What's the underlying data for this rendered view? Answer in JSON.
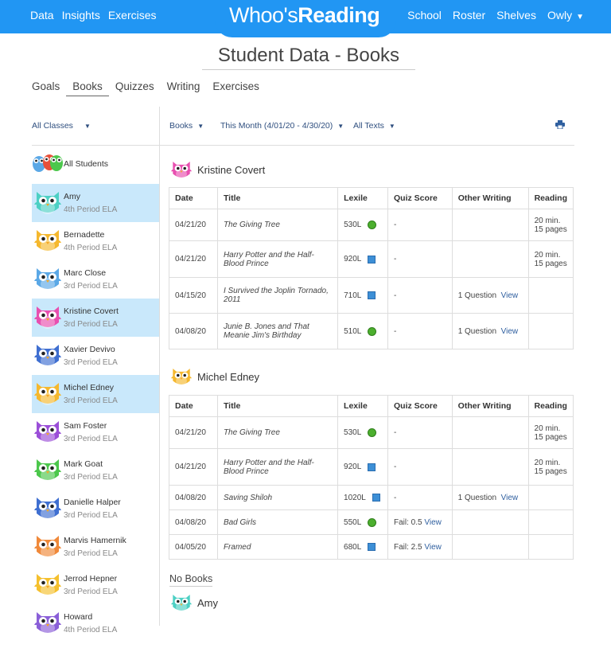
{
  "nav": {
    "left": [
      "Data",
      "Insights",
      "Exercises"
    ],
    "right": [
      "School",
      "Roster",
      "Shelves"
    ],
    "user": "Owly",
    "brand_color": "#2196f3"
  },
  "logo": {
    "part1": "Wh",
    "part2": "oo",
    "part3": "'s",
    "part4": "Reading"
  },
  "page_title": "Student Data - Books",
  "tabs": [
    "Goals",
    "Books",
    "Quizzes",
    "Writing",
    "Exercises"
  ],
  "active_tab": "Books",
  "filters": {
    "classes": "All Classes",
    "type": "Books",
    "range": "This Month (4/01/20 - 4/30/20)",
    "texts": "All Texts"
  },
  "print_icon": "printer-icon",
  "sidebar": {
    "all_label": "All Students",
    "students": [
      {
        "name": "Amy",
        "class": "4th Period ELA",
        "selected": true,
        "color": "#4dd0c4"
      },
      {
        "name": "Bernadette",
        "class": "4th Period ELA",
        "selected": false,
        "color": "#f5b82e"
      },
      {
        "name": "Marc Close",
        "class": "3rd Period ELA",
        "selected": false,
        "color": "#5ba8e6"
      },
      {
        "name": "Kristine Covert",
        "class": "3rd Period ELA",
        "selected": true,
        "color": "#e84fb0"
      },
      {
        "name": "Xavier Devivo",
        "class": "3rd Period ELA",
        "selected": false,
        "color": "#3f6fd1"
      },
      {
        "name": "Michel Edney",
        "class": "3rd Period ELA",
        "selected": true,
        "color": "#f5b82e"
      },
      {
        "name": "Sam Foster",
        "class": "3rd Period ELA",
        "selected": false,
        "color": "#9b4fd8"
      },
      {
        "name": "Mark Goat",
        "class": "3rd Period ELA",
        "selected": false,
        "color": "#4cc74c"
      },
      {
        "name": "Danielle Halper",
        "class": "3rd Period ELA",
        "selected": false,
        "color": "#3f6fd1"
      },
      {
        "name": "Marvis Hamernik",
        "class": "3rd Period ELA",
        "selected": false,
        "color": "#f0893a"
      },
      {
        "name": "Jerrod Hepner",
        "class": "3rd Period ELA",
        "selected": false,
        "color": "#f5c02e"
      },
      {
        "name": "Howard",
        "class": "4th Period ELA",
        "selected": false,
        "color": "#8a5fd8"
      }
    ]
  },
  "columns": [
    "Date",
    "Title",
    "Lexile",
    "Quiz Score",
    "Other Writing",
    "Reading"
  ],
  "sections": [
    {
      "student": "Kristine Covert",
      "color": "#e84fb0",
      "rows": [
        {
          "date": "04/21/20",
          "title": "The Giving Tree",
          "lexile": "530L",
          "marker": "dot",
          "quiz": "-",
          "quiz_view": "",
          "writing": "",
          "writing_view": "",
          "reading1": "20 min.",
          "reading2": "15 pages"
        },
        {
          "date": "04/21/20",
          "title": "Harry Potter and the Half-Blood Prince",
          "lexile": "920L",
          "marker": "square",
          "quiz": "-",
          "quiz_view": "",
          "writing": "",
          "writing_view": "",
          "reading1": "20 min.",
          "reading2": "15 pages"
        },
        {
          "date": "04/15/20",
          "title": "I Survived the Joplin Tornado, 2011",
          "lexile": "710L",
          "marker": "square",
          "quiz": "-",
          "quiz_view": "",
          "writing": "1 Question",
          "writing_view": "View",
          "reading1": "",
          "reading2": ""
        },
        {
          "date": "04/08/20",
          "title": "Junie B. Jones and That Meanie Jim's Birthday",
          "lexile": "510L",
          "marker": "dot",
          "quiz": "-",
          "quiz_view": "",
          "writing": "1 Question",
          "writing_view": "View",
          "reading1": "",
          "reading2": ""
        }
      ]
    },
    {
      "student": "Michel Edney",
      "color": "#f5b82e",
      "rows": [
        {
          "date": "04/21/20",
          "title": "The Giving Tree",
          "lexile": "530L",
          "marker": "dot",
          "quiz": "-",
          "quiz_view": "",
          "writing": "",
          "writing_view": "",
          "reading1": "20 min.",
          "reading2": "15 pages"
        },
        {
          "date": "04/21/20",
          "title": "Harry Potter and the Half-Blood Prince",
          "lexile": "920L",
          "marker": "square",
          "quiz": "-",
          "quiz_view": "",
          "writing": "",
          "writing_view": "",
          "reading1": "20 min.",
          "reading2": "15 pages"
        },
        {
          "date": "04/08/20",
          "title": "Saving Shiloh",
          "lexile": "1020L",
          "marker": "square",
          "quiz": "-",
          "quiz_view": "",
          "writing": "1 Question",
          "writing_view": "View",
          "reading1": "",
          "reading2": ""
        },
        {
          "date": "04/08/20",
          "title": "Bad Girls",
          "lexile": "550L",
          "marker": "dot",
          "quiz": "Fail: 0.5",
          "quiz_view": "View",
          "writing": "",
          "writing_view": "",
          "reading1": "",
          "reading2": ""
        },
        {
          "date": "04/05/20",
          "title": "Framed",
          "lexile": "680L",
          "marker": "square",
          "quiz": "Fail: 2.5",
          "quiz_view": "View",
          "writing": "",
          "writing_view": "",
          "reading1": "",
          "reading2": ""
        }
      ]
    }
  ],
  "no_books": {
    "label": "No Books",
    "students": [
      {
        "name": "Amy",
        "color": "#4dd0c4"
      }
    ]
  }
}
